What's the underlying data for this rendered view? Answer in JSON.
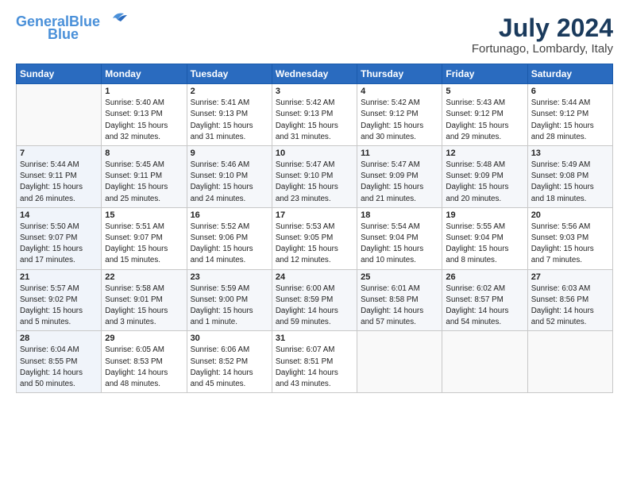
{
  "header": {
    "logo_line1": "General",
    "logo_line2": "Blue",
    "month_year": "July 2024",
    "location": "Fortunago, Lombardy, Italy"
  },
  "columns": [
    "Sunday",
    "Monday",
    "Tuesday",
    "Wednesday",
    "Thursday",
    "Friday",
    "Saturday"
  ],
  "weeks": [
    [
      {
        "day": "",
        "info": ""
      },
      {
        "day": "1",
        "info": "Sunrise: 5:40 AM\nSunset: 9:13 PM\nDaylight: 15 hours\nand 32 minutes."
      },
      {
        "day": "2",
        "info": "Sunrise: 5:41 AM\nSunset: 9:13 PM\nDaylight: 15 hours\nand 31 minutes."
      },
      {
        "day": "3",
        "info": "Sunrise: 5:42 AM\nSunset: 9:13 PM\nDaylight: 15 hours\nand 31 minutes."
      },
      {
        "day": "4",
        "info": "Sunrise: 5:42 AM\nSunset: 9:12 PM\nDaylight: 15 hours\nand 30 minutes."
      },
      {
        "day": "5",
        "info": "Sunrise: 5:43 AM\nSunset: 9:12 PM\nDaylight: 15 hours\nand 29 minutes."
      },
      {
        "day": "6",
        "info": "Sunrise: 5:44 AM\nSunset: 9:12 PM\nDaylight: 15 hours\nand 28 minutes."
      }
    ],
    [
      {
        "day": "7",
        "info": "Sunrise: 5:44 AM\nSunset: 9:11 PM\nDaylight: 15 hours\nand 26 minutes."
      },
      {
        "day": "8",
        "info": "Sunrise: 5:45 AM\nSunset: 9:11 PM\nDaylight: 15 hours\nand 25 minutes."
      },
      {
        "day": "9",
        "info": "Sunrise: 5:46 AM\nSunset: 9:10 PM\nDaylight: 15 hours\nand 24 minutes."
      },
      {
        "day": "10",
        "info": "Sunrise: 5:47 AM\nSunset: 9:10 PM\nDaylight: 15 hours\nand 23 minutes."
      },
      {
        "day": "11",
        "info": "Sunrise: 5:47 AM\nSunset: 9:09 PM\nDaylight: 15 hours\nand 21 minutes."
      },
      {
        "day": "12",
        "info": "Sunrise: 5:48 AM\nSunset: 9:09 PM\nDaylight: 15 hours\nand 20 minutes."
      },
      {
        "day": "13",
        "info": "Sunrise: 5:49 AM\nSunset: 9:08 PM\nDaylight: 15 hours\nand 18 minutes."
      }
    ],
    [
      {
        "day": "14",
        "info": "Sunrise: 5:50 AM\nSunset: 9:07 PM\nDaylight: 15 hours\nand 17 minutes."
      },
      {
        "day": "15",
        "info": "Sunrise: 5:51 AM\nSunset: 9:07 PM\nDaylight: 15 hours\nand 15 minutes."
      },
      {
        "day": "16",
        "info": "Sunrise: 5:52 AM\nSunset: 9:06 PM\nDaylight: 15 hours\nand 14 minutes."
      },
      {
        "day": "17",
        "info": "Sunrise: 5:53 AM\nSunset: 9:05 PM\nDaylight: 15 hours\nand 12 minutes."
      },
      {
        "day": "18",
        "info": "Sunrise: 5:54 AM\nSunset: 9:04 PM\nDaylight: 15 hours\nand 10 minutes."
      },
      {
        "day": "19",
        "info": "Sunrise: 5:55 AM\nSunset: 9:04 PM\nDaylight: 15 hours\nand 8 minutes."
      },
      {
        "day": "20",
        "info": "Sunrise: 5:56 AM\nSunset: 9:03 PM\nDaylight: 15 hours\nand 7 minutes."
      }
    ],
    [
      {
        "day": "21",
        "info": "Sunrise: 5:57 AM\nSunset: 9:02 PM\nDaylight: 15 hours\nand 5 minutes."
      },
      {
        "day": "22",
        "info": "Sunrise: 5:58 AM\nSunset: 9:01 PM\nDaylight: 15 hours\nand 3 minutes."
      },
      {
        "day": "23",
        "info": "Sunrise: 5:59 AM\nSunset: 9:00 PM\nDaylight: 15 hours\nand 1 minute."
      },
      {
        "day": "24",
        "info": "Sunrise: 6:00 AM\nSunset: 8:59 PM\nDaylight: 14 hours\nand 59 minutes."
      },
      {
        "day": "25",
        "info": "Sunrise: 6:01 AM\nSunset: 8:58 PM\nDaylight: 14 hours\nand 57 minutes."
      },
      {
        "day": "26",
        "info": "Sunrise: 6:02 AM\nSunset: 8:57 PM\nDaylight: 14 hours\nand 54 minutes."
      },
      {
        "day": "27",
        "info": "Sunrise: 6:03 AM\nSunset: 8:56 PM\nDaylight: 14 hours\nand 52 minutes."
      }
    ],
    [
      {
        "day": "28",
        "info": "Sunrise: 6:04 AM\nSunset: 8:55 PM\nDaylight: 14 hours\nand 50 minutes."
      },
      {
        "day": "29",
        "info": "Sunrise: 6:05 AM\nSunset: 8:53 PM\nDaylight: 14 hours\nand 48 minutes."
      },
      {
        "day": "30",
        "info": "Sunrise: 6:06 AM\nSunset: 8:52 PM\nDaylight: 14 hours\nand 45 minutes."
      },
      {
        "day": "31",
        "info": "Sunrise: 6:07 AM\nSunset: 8:51 PM\nDaylight: 14 hours\nand 43 minutes."
      },
      {
        "day": "",
        "info": ""
      },
      {
        "day": "",
        "info": ""
      },
      {
        "day": "",
        "info": ""
      }
    ]
  ]
}
